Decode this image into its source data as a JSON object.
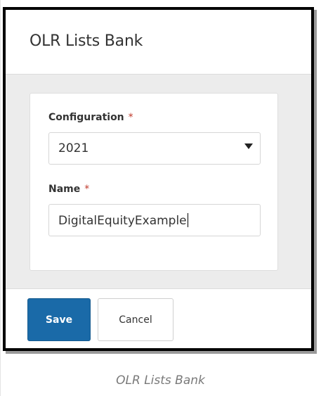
{
  "dialog": {
    "title": "OLR Lists Bank"
  },
  "form": {
    "configuration": {
      "label": "Configuration",
      "required_marker": "*",
      "value": "2021"
    },
    "name": {
      "label": "Name",
      "required_marker": "*",
      "value": "DigitalEquityExample"
    }
  },
  "footer": {
    "save_label": "Save",
    "cancel_label": "Cancel"
  },
  "caption": "OLR Lists Bank",
  "colors": {
    "primary_button": "#1a6aa8",
    "required_marker": "#c0392b",
    "body_background": "#ececec"
  },
  "icons": {
    "select_caret": "triangle-down"
  }
}
